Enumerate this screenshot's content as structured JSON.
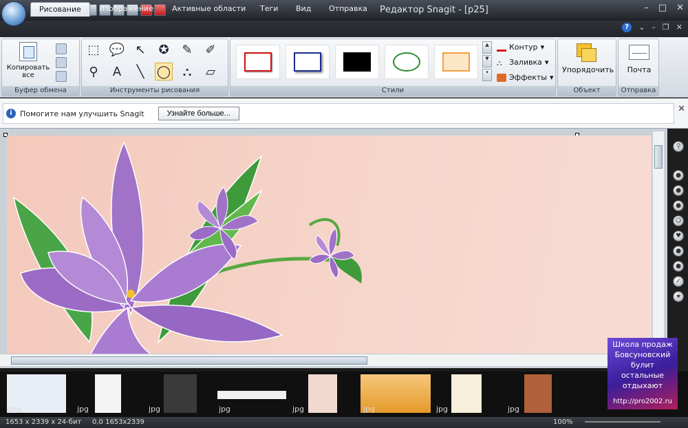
{
  "window": {
    "title": "Редактор Snagit - [p25]"
  },
  "tabs": [
    "Рисование",
    "Изображение",
    "Активные области",
    "Теги",
    "Вид",
    "Отправка"
  ],
  "ribbon": {
    "clipboard": {
      "copy_label": "Копировать все",
      "group_label": "Буфер обмена"
    },
    "tools": {
      "group_label": "Инструменты рисования",
      "items": [
        "selection",
        "callout",
        "arrow",
        "stamp",
        "pen",
        "highlighter",
        "zoom",
        "text",
        "line",
        "shape",
        "fill",
        "eraser"
      ]
    },
    "styles": {
      "group_label": "Стили",
      "swatch_colors": [
        "#cc1111",
        "#1a2a8c",
        "#000000",
        "#2d8a2d",
        "#f0a040"
      ]
    },
    "format": {
      "outline": "Контур",
      "fill": "Заливка",
      "effects": "Эффекты"
    },
    "object": {
      "arrange": "Упорядочить",
      "group_label": "Объект"
    },
    "send": {
      "mail": "Почта",
      "group_label": "Отправка"
    }
  },
  "infobar": {
    "message": "Помогите нам улучшить Snagit",
    "button": "Узнайте больше..."
  },
  "tray": {
    "items": [
      {
        "ext": "png"
      },
      {
        "ext": "jpg"
      },
      {
        "ext": "jpg"
      },
      {
        "ext": "jpg"
      },
      {
        "ext": "jpg"
      },
      {
        "ext": "jpg"
      },
      {
        "ext": "jpg"
      },
      {
        "ext": "jpg"
      }
    ]
  },
  "status": {
    "dimensions": "1653 x 2339 x 24-бит",
    "coords": "0,0 1653x2339",
    "zoom": "100%"
  },
  "watermark": {
    "lines": [
      "Школа продаж",
      "Бовсуновский",
      "булит",
      "остальные",
      "отдыхают",
      "http://pro2002.ru"
    ]
  }
}
